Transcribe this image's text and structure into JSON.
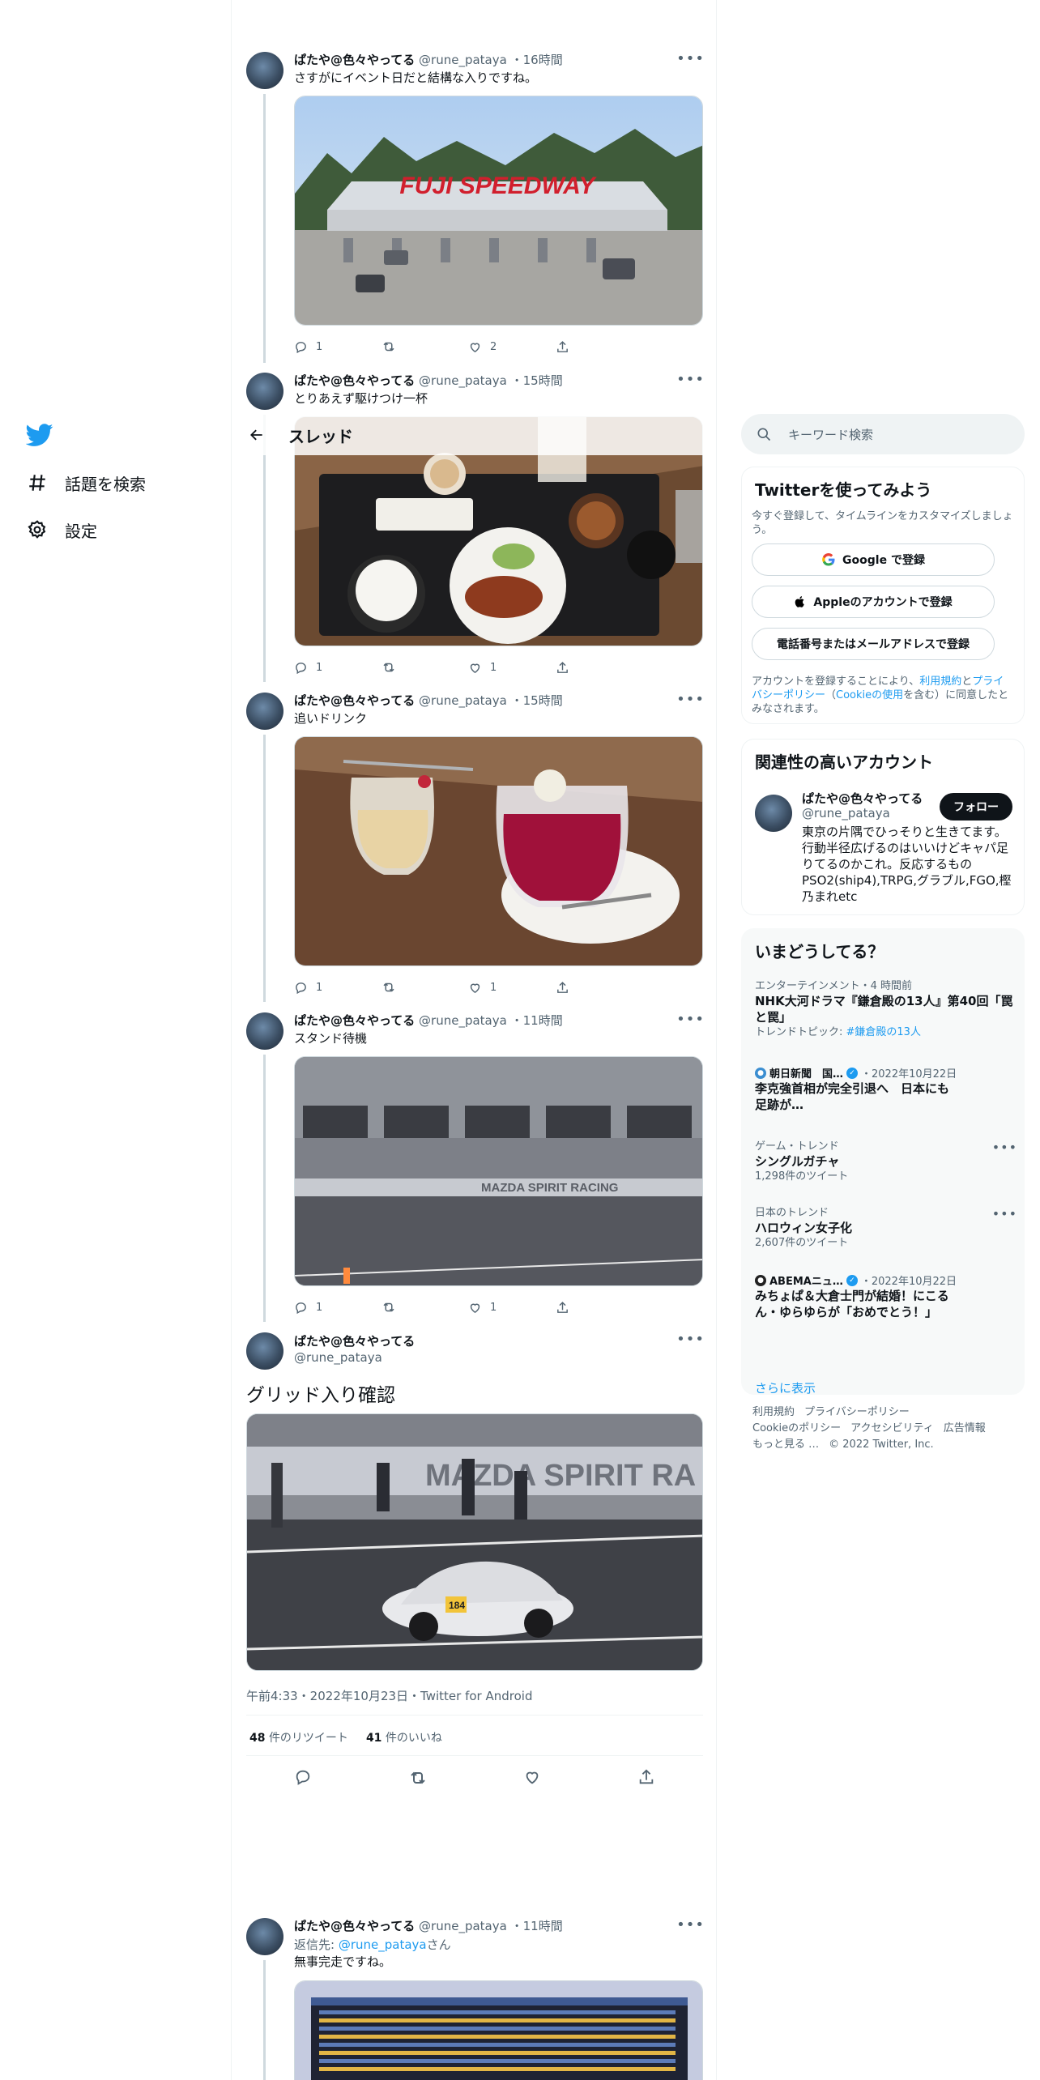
{
  "nav": {
    "explore_label": "話題を検索",
    "settings_label": "設定"
  },
  "header": {
    "title": "スレッド"
  },
  "tweets": [
    {
      "name": "ぱたや@色々やってる",
      "handle": "@rune_pataya",
      "time": "16時間",
      "text": "さすがにイベント日だと結構な入りですね。",
      "media_label": "FUJI SPEEDWAY",
      "replies": "1",
      "retweets": "",
      "likes": "2"
    },
    {
      "name": "ぱたや@色々やってる",
      "handle": "@rune_pataya",
      "time": "15時間",
      "text": "とりあえず駆けつけ一杯",
      "replies": "1",
      "retweets": "",
      "likes": "1"
    },
    {
      "name": "ぱたや@色々やってる",
      "handle": "@rune_pataya",
      "time": "15時間",
      "text": "追いドリンク",
      "replies": "1",
      "retweets": "",
      "likes": "1"
    },
    {
      "name": "ぱたや@色々やってる",
      "handle": "@rune_pataya",
      "time": "11時間",
      "text": "スタンド待機",
      "media_label": "MAZDA SPIRIT RACING",
      "replies": "1",
      "retweets": "",
      "likes": "1"
    }
  ],
  "focus": {
    "name": "ぱたや@色々やってる",
    "handle": "@rune_pataya",
    "text": "グリッド入り確認",
    "media_label": "MAZDA SPIRIT RA",
    "car_number": "184",
    "timestamp": "午前4:33・2022年10月23日・Twitter for Android",
    "retweet_count": "48",
    "retweet_label": "件のリツイート",
    "like_count": "41",
    "like_label": "件のいいね"
  },
  "reply": {
    "name": "ぱたや@色々やってる",
    "handle": "@rune_pataya",
    "time": "11時間",
    "reply_to_prefix": "返信先: ",
    "reply_to_handle": "@rune_pataya",
    "reply_to_suffix": "さん",
    "text": "無事完走ですね。"
  },
  "search": {
    "placeholder": "キーワード検索"
  },
  "signup_card": {
    "title": "Twitterを使ってみよう",
    "subtitle": "今すぐ登録して、タイムラインをカスタマイズしましょう。",
    "google_label": "Google で登録",
    "apple_label": "Appleのアカウントで登録",
    "phone_label": "電話番号またはメールアドレスで登録",
    "terms_prefix": "アカウントを登録することにより、",
    "terms_link1": "利用規約",
    "terms_and": "と",
    "terms_link2": "プライバシーポリシー",
    "terms_paren_open": "（",
    "terms_link3": "Cookieの使用",
    "terms_suffix": "を含む）に同意したとみなされます。"
  },
  "related_card": {
    "title": "関連性の高いアカウント",
    "name": "ぱたや@色々やってる",
    "handle": "@rune_pataya",
    "follow_label": "フォロー",
    "bio": "東京の片隅でひっそりと生きてます。行動半径広げるのはいいけどキャパ足りてるのかこれ。反応するものPSO2(ship4),TRPG,グラブル,FGO,樫乃まれetc"
  },
  "trends_card": {
    "title": "いまどうしてる？",
    "items": [
      {
        "category": "エンターテインメント・4 時間前",
        "title": "NHK大河ドラマ『鎌倉殿の13人』第40回「罠と罠」",
        "sub_prefix": "トレンドトピック: ",
        "sub_link": "#鎌倉殿の13人"
      },
      {
        "source": "朝日新聞　国…",
        "date": "・2022年10月22日",
        "title": "李克強首相が完全引退へ　日本にも足跡が…"
      },
      {
        "category": "ゲーム・トレンド",
        "title": "シングルガチャ",
        "sub": "1,298件のツイート"
      },
      {
        "category": "日本のトレンド",
        "title": "ハロウィン女子化",
        "sub": "2,607件のツイート"
      },
      {
        "source": "ABEMAニュ…",
        "date": "・2022年10月22日",
        "title": "みちょぱ＆大倉士門が結婚！にこるん・ゆらゆらが「おめでとう！」"
      }
    ],
    "show_more": "さらに表示"
  },
  "footer": {
    "links": [
      "利用規約",
      "プライバシーポリシー",
      "Cookieのポリシー",
      "アクセシビリティ",
      "広告情報",
      "もっと見る …"
    ],
    "copyright": "© 2022 Twitter, Inc."
  },
  "colors": {
    "accent": "#1d9bf0",
    "text": "#0f1419",
    "muted": "#536471",
    "border": "#eff3f4"
  }
}
